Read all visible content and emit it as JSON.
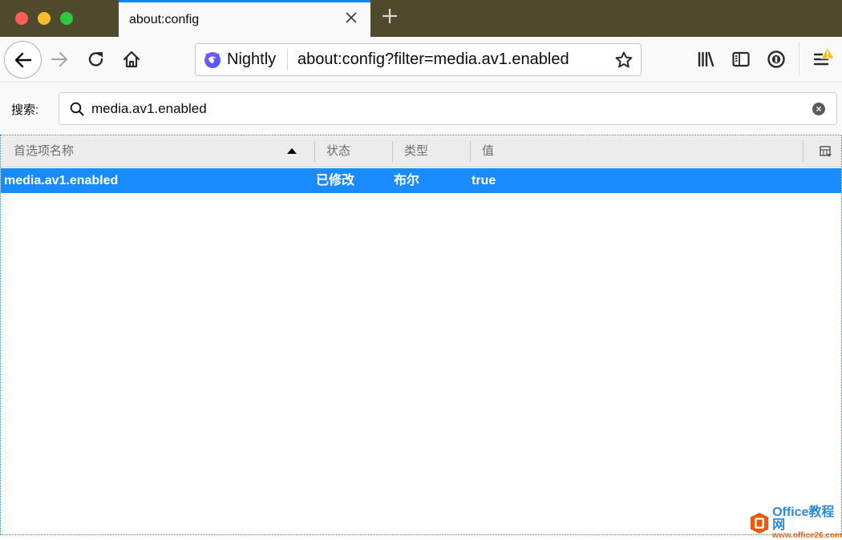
{
  "window": {
    "tab_title": "about:config",
    "tab_close_icon": "close-icon",
    "new_tab_icon": "plus-icon"
  },
  "toolbar": {
    "back_icon": "arrow-left-icon",
    "forward_icon": "arrow-right-icon",
    "reload_icon": "reload-icon",
    "home_icon": "home-icon",
    "identity_label": "Nightly",
    "url": "about:config?filter=media.av1.enabled",
    "bookmark_icon": "star-icon",
    "library_icon": "library-icon",
    "sidebar_icon": "sidebar-icon",
    "info_icon": "info-icon",
    "menu_icon": "hamburger-menu-icon",
    "menu_badge": "warning-icon"
  },
  "search": {
    "label": "搜索:",
    "value": "media.av1.enabled",
    "clear_icon": "clear-icon"
  },
  "tree": {
    "columns": [
      {
        "label": "首选项名称",
        "sorted": "ascending"
      },
      {
        "label": "状态"
      },
      {
        "label": "类型"
      },
      {
        "label": "值"
      }
    ],
    "rows": [
      {
        "name": "media.av1.enabled",
        "status": "已修改",
        "type": "布尔",
        "value": "true",
        "selected": true
      }
    ],
    "colors": {
      "selected_row": "#1a8bfd"
    }
  },
  "watermark": {
    "title": "Office教程网",
    "url": "www.office26.com"
  }
}
